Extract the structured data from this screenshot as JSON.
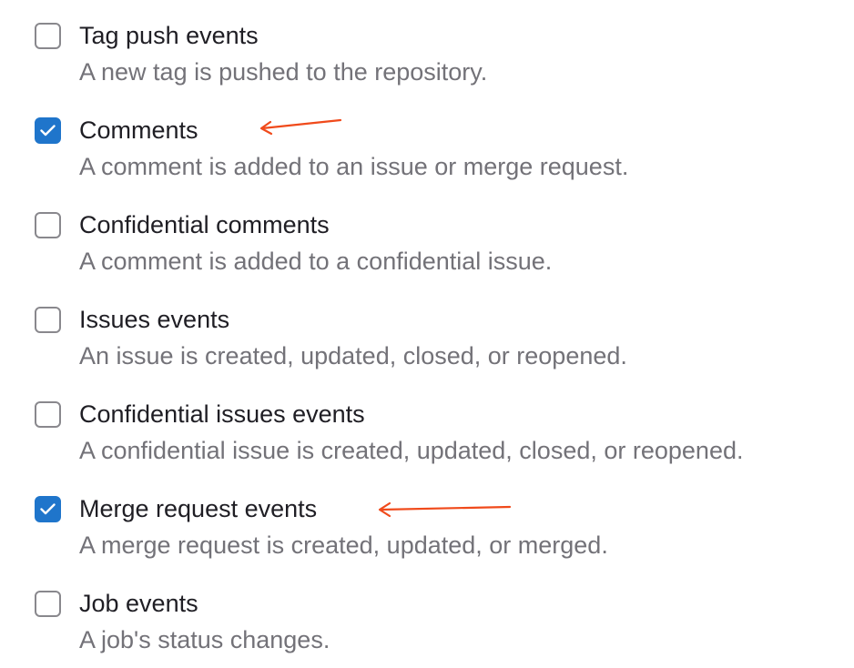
{
  "triggers": [
    {
      "label": "Tag push events",
      "description": "A new tag is pushed to the repository.",
      "checked": false
    },
    {
      "label": "Comments",
      "description": "A comment is added to an issue or merge request.",
      "checked": true
    },
    {
      "label": "Confidential comments",
      "description": "A comment is added to a confidential issue.",
      "checked": false
    },
    {
      "label": "Issues events",
      "description": "An issue is created, updated, closed, or reopened.",
      "checked": false
    },
    {
      "label": "Confidential issues events",
      "description": "A confidential issue is created, updated, closed, or reopened.",
      "checked": false
    },
    {
      "label": "Merge request events",
      "description": "A merge request is created, updated, or merged.",
      "checked": true
    },
    {
      "label": "Job events",
      "description": "A job's status changes.",
      "checked": false
    }
  ],
  "icons": {
    "check": "check-icon",
    "annotation": "arrow-left-icon"
  },
  "colors": {
    "checkbox_checked": "#1f75cb",
    "checkbox_border": "#89888d",
    "label_text": "#1f1e24",
    "description_text": "#737278",
    "annotation_arrow": "#f04a1b"
  }
}
